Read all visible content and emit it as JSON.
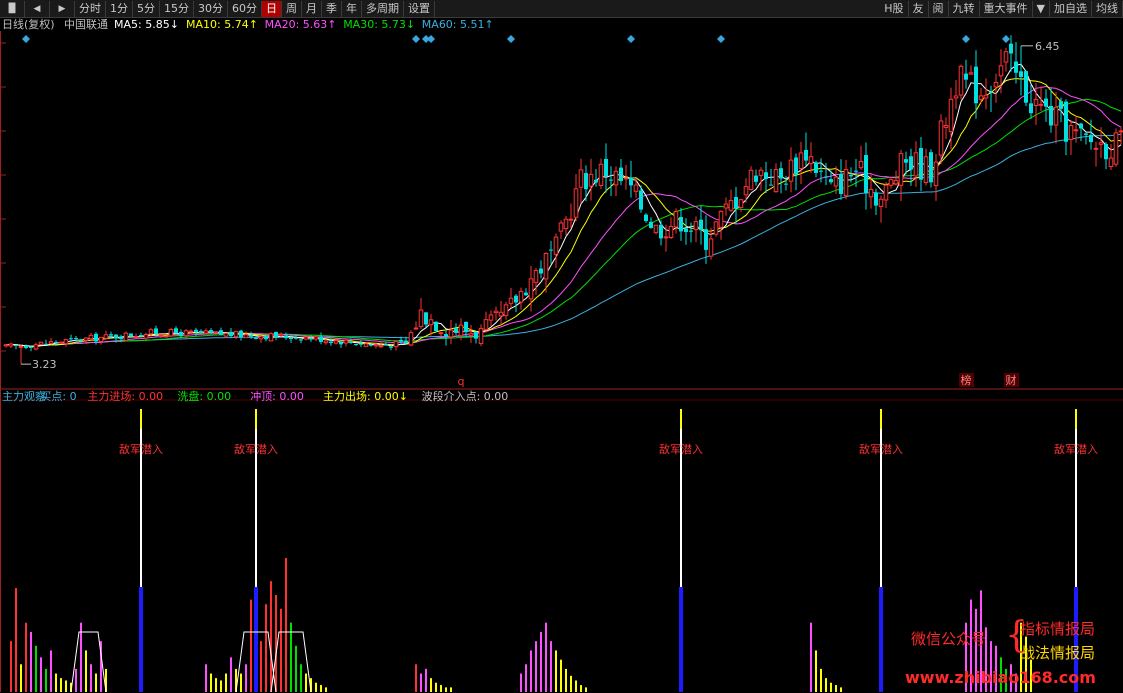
{
  "toolbar": {
    "icons": [
      "bars-icon",
      "back-icon",
      "forward-icon"
    ],
    "periods": [
      "分时",
      "1分",
      "5分",
      "15分",
      "30分",
      "60分",
      "日",
      "周",
      "月",
      "季",
      "年",
      "多周期",
      "设置"
    ],
    "active_period": "日",
    "right_buttons": [
      "H股",
      "友",
      "阅",
      "九转",
      "重大事件"
    ],
    "right_dropdown": "▼",
    "far_right": [
      "加自选",
      "均线"
    ]
  },
  "colors": {
    "up": "#ff3232",
    "down": "#00e0e0",
    "ma5": "#ffffff",
    "ma10": "#ffff00",
    "ma20": "#ff50ff",
    "ma30": "#00e000",
    "ma60": "#3ab0e0",
    "diamond": "#3aa8e0"
  },
  "chart_data": [
    {
      "type": "candlestick",
      "title": "日线(复权)",
      "stock": "中国联通",
      "ma_legend": [
        {
          "name": "MA5",
          "value": "5.85",
          "arrow": "↓",
          "color": "#ffffff"
        },
        {
          "name": "MA10",
          "value": "5.74",
          "arrow": "↑",
          "color": "#ffff00"
        },
        {
          "name": "MA20",
          "value": "5.63",
          "arrow": "↑",
          "color": "#ff50ff"
        },
        {
          "name": "MA30",
          "value": "5.73",
          "arrow": "↓",
          "color": "#00e000"
        },
        {
          "name": "MA60",
          "value": "5.51",
          "arrow": "↑",
          "color": "#3ab0e0"
        }
      ],
      "high_label": "6.45",
      "low_label": "3.23",
      "ylim": [
        3.1,
        6.6
      ],
      "anchors": [
        [
          0,
          3.4
        ],
        [
          15,
          3.48
        ],
        [
          30,
          3.55
        ],
        [
          45,
          3.53
        ],
        [
          60,
          3.5
        ],
        [
          75,
          3.42
        ],
        [
          80,
          3.44
        ],
        [
          83,
          3.75
        ],
        [
          88,
          3.6
        ],
        [
          95,
          3.55
        ],
        [
          100,
          3.75
        ],
        [
          105,
          4.1
        ],
        [
          110,
          4.4
        ],
        [
          115,
          5.1
        ],
        [
          120,
          5.2
        ],
        [
          125,
          5.0
        ],
        [
          130,
          4.6
        ],
        [
          135,
          4.7
        ],
        [
          140,
          4.5
        ],
        [
          145,
          4.85
        ],
        [
          150,
          5.2
        ],
        [
          155,
          5.1
        ],
        [
          160,
          5.4
        ],
        [
          165,
          5.0
        ],
        [
          170,
          5.2
        ],
        [
          175,
          4.9
        ],
        [
          180,
          5.3
        ],
        [
          185,
          5.2
        ],
        [
          190,
          6.1
        ],
        [
          195,
          6.0
        ],
        [
          200,
          6.3
        ],
        [
          205,
          5.9
        ],
        [
          210,
          5.7
        ],
        [
          215,
          5.5
        ],
        [
          220,
          5.45
        ]
      ],
      "markers": {
        "top_diamond_indices": [
          4,
          82,
          84,
          85,
          101,
          125,
          143,
          192,
          200
        ],
        "red_q_index": 91,
        "red_q_text": "q",
        "bottom_badges": [
          {
            "index": 192,
            "text": "榜"
          },
          {
            "index": 201,
            "text": "财"
          }
        ]
      }
    },
    {
      "type": "bar",
      "indicator_legend": [
        {
          "name": "主力观察",
          "value": "",
          "color": "#3ab0e0"
        },
        {
          "name": "买点",
          "value": "0",
          "color": "#3ab0e0"
        },
        {
          "name": "主力进场",
          "value": "0.00",
          "color": "#ff3232",
          "label_color": "#ff3232"
        },
        {
          "name": "洗盘",
          "value": "0.00",
          "color": "#00e000"
        },
        {
          "name": "冲顶",
          "value": "0.00",
          "color": "#ff50ff"
        },
        {
          "name": "主力出场",
          "value": "0.00↓",
          "color": "#ffff00"
        },
        {
          "name": "波段介入点",
          "value": "0.00",
          "color": "#c0c0c0"
        }
      ],
      "signal_label": "敌军潜入",
      "signal_indices": [
        27,
        50,
        135,
        175,
        214
      ],
      "bar_groups": [
        {
          "start": 1,
          "values": [
            22,
            45,
            12,
            30,
            26,
            20,
            15,
            10,
            18,
            8,
            6,
            5,
            4,
            10,
            30,
            18,
            12,
            8,
            22,
            10
          ],
          "colors": [
            "#ff3232",
            "#ff3232",
            "#ffff00",
            "#ff3232",
            "#ff50ff",
            "#00e000",
            "#ff50ff",
            "#00e000",
            "#ff50ff",
            "#ffff00",
            "#ffff00",
            "#ffff00",
            "#ffff00",
            "#ff50ff",
            "#ff50ff",
            "#ffff00",
            "#ff50ff",
            "#ffff00",
            "#ff50ff",
            "#ffff00"
          ]
        },
        {
          "start": 40,
          "values": [
            12,
            8,
            6,
            5,
            8,
            15,
            10,
            8,
            12,
            40,
            28,
            22,
            38,
            48,
            42,
            36,
            58,
            30,
            20,
            12,
            8,
            6,
            4,
            3,
            2
          ],
          "colors": [
            "#ff50ff",
            "#ffff00",
            "#ffff00",
            "#ffff00",
            "#ffff00",
            "#ff50ff",
            "#ffff00",
            "#ffff00",
            "#ff50ff",
            "#ff3232",
            "#ff3232",
            "#ff3232",
            "#ff3232",
            "#ff3232",
            "#ff3232",
            "#ff3232",
            "#ff3232",
            "#00e000",
            "#00e000",
            "#00e000",
            "#ffff00",
            "#ffff00",
            "#ffff00",
            "#ffff00",
            "#ffff00"
          ]
        },
        {
          "start": 82,
          "values": [
            12,
            8,
            10,
            6,
            4,
            3,
            2,
            2
          ],
          "colors": [
            "#ff3232",
            "#ff50ff",
            "#ff50ff",
            "#ffff00",
            "#ffff00",
            "#ffff00",
            "#ffff00",
            "#ffff00"
          ]
        },
        {
          "start": 103,
          "values": [
            8,
            12,
            18,
            22,
            26,
            30,
            22,
            18,
            14,
            10,
            7,
            5,
            3,
            2
          ],
          "colors": [
            "#ff50ff",
            "#ff50ff",
            "#ff50ff",
            "#ff50ff",
            "#ff50ff",
            "#ff50ff",
            "#ff50ff",
            "#ffff00",
            "#ffff00",
            "#ffff00",
            "#ffff00",
            "#ffff00",
            "#ffff00",
            "#ffff00"
          ]
        },
        {
          "start": 161,
          "values": [
            30,
            18,
            10,
            6,
            4,
            3,
            2
          ],
          "colors": [
            "#ff50ff",
            "#ffff00",
            "#ffff00",
            "#ffff00",
            "#ffff00",
            "#ffff00",
            "#ffff00"
          ]
        },
        {
          "start": 192,
          "values": [
            30,
            40,
            36,
            44,
            28,
            22,
            20,
            15,
            10,
            12,
            8,
            30,
            24,
            14
          ],
          "colors": [
            "#ff50ff",
            "#ff50ff",
            "#ff50ff",
            "#ff50ff",
            "#ff50ff",
            "#ff50ff",
            "#ff50ff",
            "#00e000",
            "#00e000",
            "#ff50ff",
            "#ff50ff",
            "#ffff00",
            "#ffff00",
            "#ffff00"
          ]
        }
      ],
      "ylim": [
        0,
        100
      ]
    }
  ],
  "watermark": {
    "left": "微信公众号",
    "brace": "{",
    "line1": "指标情报局",
    "line2": "战法情报局",
    "url": "www.zhibiao168.com"
  }
}
